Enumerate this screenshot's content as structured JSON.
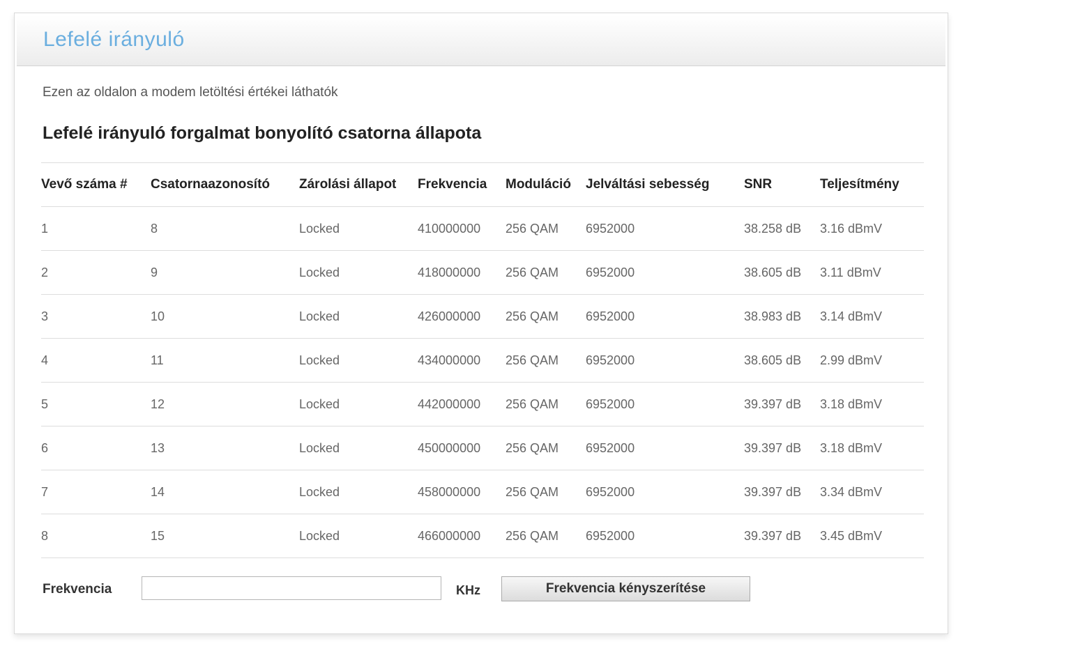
{
  "panel": {
    "title": "Lefelé irányuló",
    "intro": "Ezen az oldalon a modem letöltési értékei láthatók",
    "section_title": "Lefelé irányuló forgalmat bonyolító csatorna állapota"
  },
  "table": {
    "headers": [
      "Vevő száma #",
      "Csatornaazonosító",
      "Zárolási állapot",
      "Frekvencia",
      "Moduláció",
      "Jelváltási sebesség",
      "SNR",
      "Teljesítmény"
    ],
    "rows": [
      [
        "1",
        "8",
        "Locked",
        "410000000",
        "256 QAM",
        "6952000",
        "38.258 dB",
        "3.16 dBmV"
      ],
      [
        "2",
        "9",
        "Locked",
        "418000000",
        "256 QAM",
        "6952000",
        "38.605 dB",
        "3.11 dBmV"
      ],
      [
        "3",
        "10",
        "Locked",
        "426000000",
        "256 QAM",
        "6952000",
        "38.983 dB",
        "3.14 dBmV"
      ],
      [
        "4",
        "11",
        "Locked",
        "434000000",
        "256 QAM",
        "6952000",
        "38.605 dB",
        "2.99 dBmV"
      ],
      [
        "5",
        "12",
        "Locked",
        "442000000",
        "256 QAM",
        "6952000",
        "39.397 dB",
        "3.18 dBmV"
      ],
      [
        "6",
        "13",
        "Locked",
        "450000000",
        "256 QAM",
        "6952000",
        "39.397 dB",
        "3.18 dBmV"
      ],
      [
        "7",
        "14",
        "Locked",
        "458000000",
        "256 QAM",
        "6952000",
        "39.397 dB",
        "3.34 dBmV"
      ],
      [
        "8",
        "15",
        "Locked",
        "466000000",
        "256 QAM",
        "6952000",
        "39.397 dB",
        "3.45 dBmV"
      ]
    ]
  },
  "form": {
    "label": "Frekvencia",
    "input_value": "",
    "unit": "KHz",
    "button_label": "Frekvencia kényszerítése"
  },
  "colors": {
    "title": "#6aaedf",
    "border": "#d9d9d9",
    "divider": "#dddddd"
  }
}
